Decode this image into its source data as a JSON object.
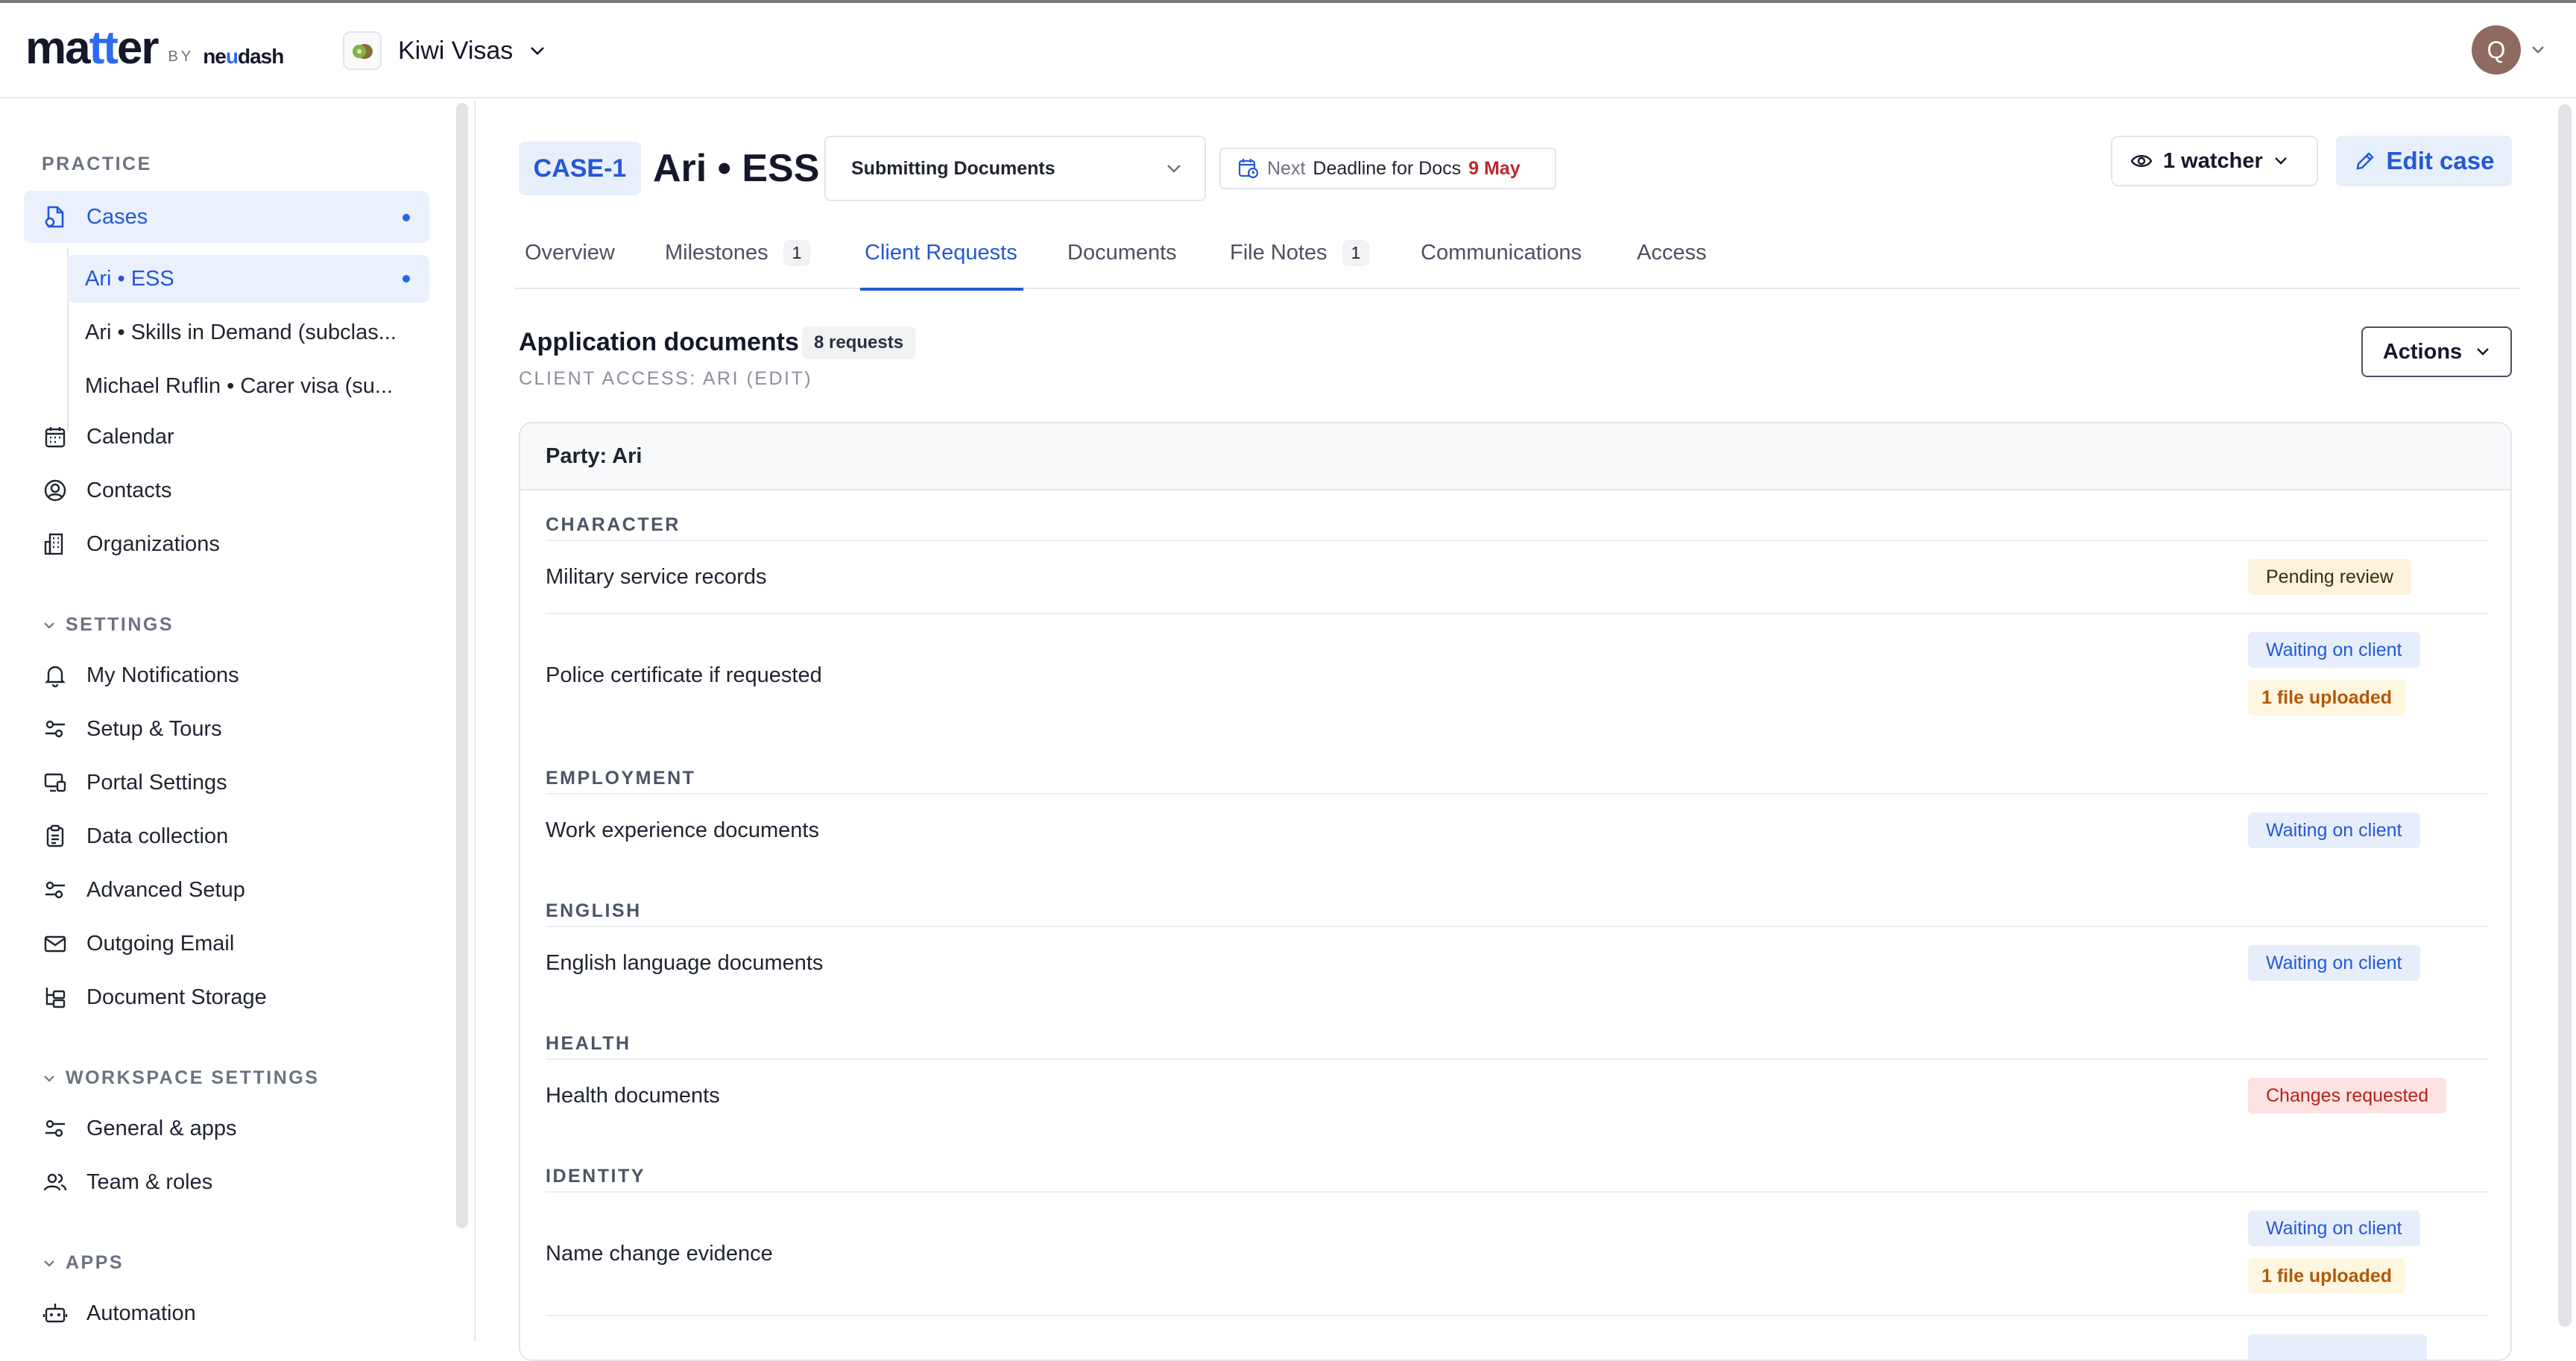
{
  "app": {
    "logo": "matter",
    "logo_by": "BY",
    "logo_sub": "neudash",
    "workspace": "Kiwi Visas",
    "avatar_initial": "Q"
  },
  "sidebar": {
    "practice_label": "PRACTICE",
    "cases_label": "Cases",
    "sub_cases": [
      "Ari • ESS",
      "Ari • Skills in Demand (subclas...",
      "Michael Ruflin • Carer visa (su..."
    ],
    "calendar": "Calendar",
    "contacts": "Contacts",
    "organizations": "Organizations",
    "settings_label": "SETTINGS",
    "settings_items": [
      "My Notifications",
      "Setup & Tours",
      "Portal Settings",
      "Data collection",
      "Advanced Setup",
      "Outgoing Email",
      "Document Storage"
    ],
    "workspace_settings_label": "WORKSPACE SETTINGS",
    "workspace_items": [
      "General & apps",
      "Team & roles"
    ],
    "apps_label": "APPS",
    "apps_items": [
      "Automation"
    ]
  },
  "case": {
    "id": "CASE-1",
    "title": "Ari • ESS",
    "stage": "Submitting Documents",
    "deadline_prefix": "Next",
    "deadline_label": "Deadline for Docs",
    "deadline_date": "9 May",
    "watcher": "1 watcher",
    "edit": "Edit case"
  },
  "tabs": [
    {
      "label": "Overview",
      "count": ""
    },
    {
      "label": "Milestones",
      "count": "1"
    },
    {
      "label": "Client Requests",
      "count": ""
    },
    {
      "label": "Documents",
      "count": ""
    },
    {
      "label": "File Notes",
      "count": "1"
    },
    {
      "label": "Communications",
      "count": ""
    },
    {
      "label": "Access",
      "count": ""
    }
  ],
  "section": {
    "title": "Application documents",
    "count": "8 requests",
    "access": "CLIENT ACCESS: ARI (EDIT)",
    "actions": "Actions",
    "party": "Party: Ari"
  },
  "categories": [
    "CHARACTER",
    "EMPLOYMENT",
    "ENGLISH",
    "HEALTH",
    "IDENTITY"
  ],
  "requests": [
    {
      "name": "Military service records",
      "status": "Pending review",
      "extra": ""
    },
    {
      "name": "Police certificate if requested",
      "status": "Waiting on client",
      "extra": "1 file uploaded"
    },
    {
      "name": "Work experience documents",
      "status": "Waiting on client",
      "extra": ""
    },
    {
      "name": "English language documents",
      "status": "Waiting on client",
      "extra": ""
    },
    {
      "name": "Health documents",
      "status": "Changes requested",
      "extra": ""
    },
    {
      "name": "Name change evidence",
      "status": "Waiting on client",
      "extra": "1 file uploaded"
    }
  ],
  "colors": {
    "accent": "#2458d6",
    "active_bg": "#eaf1fd",
    "deadline_red": "#c0272d"
  }
}
